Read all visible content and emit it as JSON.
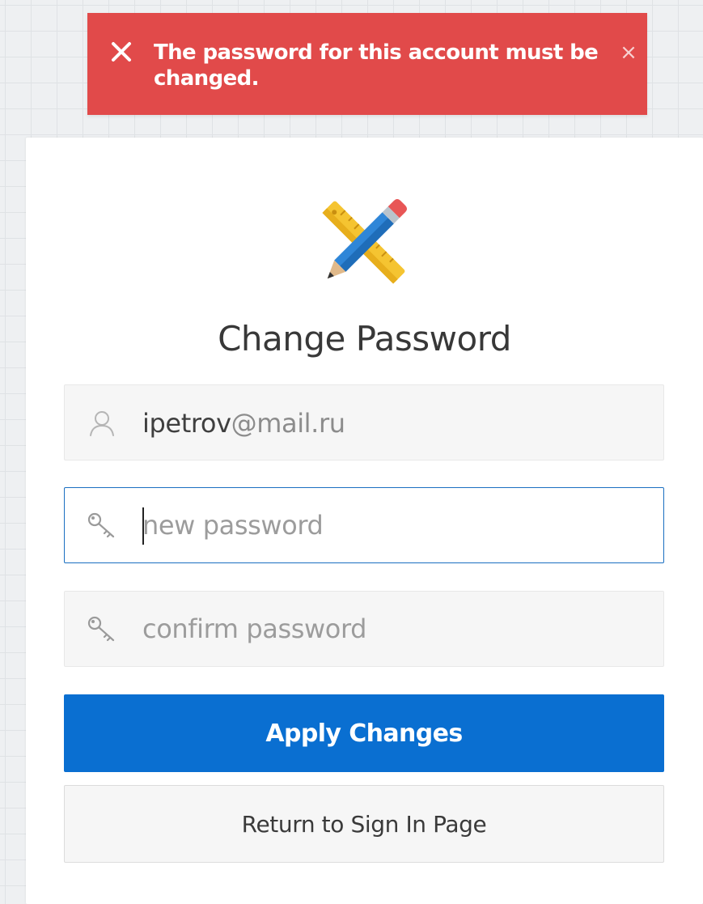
{
  "alert": {
    "message": "The password for this account must be changed.",
    "icon": "x-icon",
    "close_glyph": "×",
    "color": "#e14a4a"
  },
  "logo": {
    "icon": "pencil-ruler-icon"
  },
  "page": {
    "title": "Change Password"
  },
  "username_field": {
    "user": "ipetrov",
    "domain": "@mail.ru",
    "icon": "user-icon"
  },
  "new_password_field": {
    "value": "",
    "placeholder": "new password",
    "icon": "key-icon",
    "focused": true
  },
  "confirm_password_field": {
    "value": "",
    "placeholder": "confirm password",
    "icon": "key-icon"
  },
  "actions": {
    "apply_label": "Apply Changes",
    "return_label": "Return to Sign In Page",
    "primary_color": "#0a6fd1"
  }
}
